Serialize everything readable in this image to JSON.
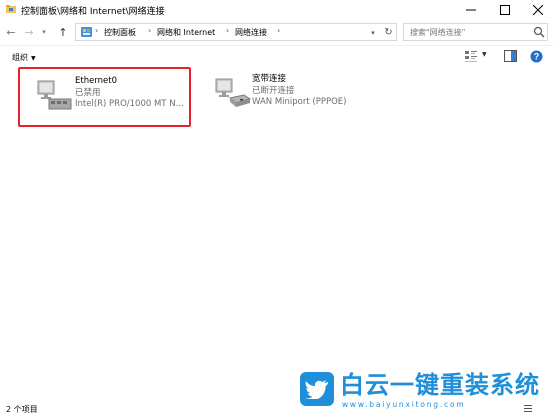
{
  "window": {
    "title": "控制面板\\网络和 Internet\\网络连接"
  },
  "address": {
    "crumbs": [
      "控制面板",
      "网络和 Internet",
      "网络连接"
    ],
    "search_placeholder": "搜索\"网络连接\""
  },
  "toolbar": {
    "organize_label": "组织"
  },
  "items": [
    {
      "name": "Ethernet0",
      "status": "已禁用",
      "device": "Intel(R) PRO/1000 MT N...",
      "selected": true
    },
    {
      "name": "宽带连接",
      "status": "已断开连接",
      "device": "WAN Miniport (PPPOE)",
      "selected": false
    }
  ],
  "statusbar": {
    "count": "2 个项目"
  },
  "watermark": {
    "brand": "白云一键重装系统",
    "url": "www.baiyunxitong.com"
  },
  "colors": {
    "selection_border": "#e5232b",
    "watermark_blue": "#1e8fd8",
    "secondary_text": "#6d6d6d"
  }
}
